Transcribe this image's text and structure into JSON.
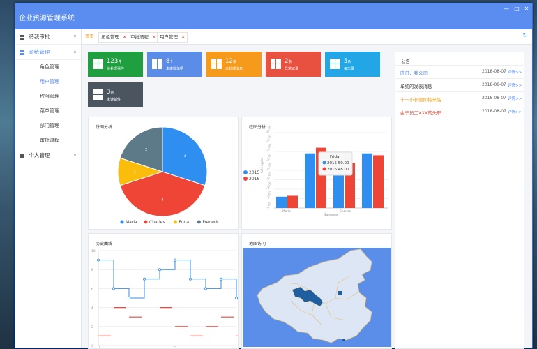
{
  "app": {
    "title": "企业资源管理系统"
  },
  "window_controls": [
    "—",
    "□",
    "✕"
  ],
  "sidebar": {
    "groups": [
      {
        "label": "待我审批",
        "chevron": "∨"
      },
      {
        "label": "系统管理",
        "chevron": "∧",
        "items": [
          "角色管理",
          "用户管理",
          "权限管理",
          "菜单管理",
          "部门管理",
          "审批流程"
        ]
      },
      {
        "label": "个人管理",
        "chevron": "∨"
      }
    ]
  },
  "tabs": {
    "home": "首页",
    "items": [
      "角色管理",
      "审批流程",
      "用户管理"
    ],
    "close": "✕",
    "refresh_icon": "↻"
  },
  "tiles": [
    {
      "num": "123",
      "unit": "件",
      "label": "待处理事件",
      "color": "#1f9f3f"
    },
    {
      "num": "8",
      "unit": "个",
      "label": "未审批单据",
      "color": "#5b8de8"
    },
    {
      "num": "12",
      "unit": "条",
      "label": "未处理消息",
      "color": "#f59a1b"
    },
    {
      "num": "2",
      "unit": "条",
      "label": "异常记录",
      "color": "#e85040"
    },
    {
      "num": "5",
      "unit": "条",
      "label": "备忘录",
      "color": "#22a6e6"
    },
    {
      "num": "3",
      "unit": "条",
      "label": "未读邮件",
      "color": "#4a5560"
    }
  ],
  "panels": {
    "pie_title": "饼图分析",
    "bar_title": "柱图分析",
    "line_title": "历史曲线",
    "map_title": "地图访问",
    "notice_title": "公告"
  },
  "notices": [
    {
      "text": "昨日，我公司",
      "date": "2018-08-07",
      "more": "详情>>",
      "color": "#5b8df0"
    },
    {
      "text": "单纯的发表消息",
      "date": "2018-08-07",
      "more": "详情>>",
      "color": "#333333"
    },
    {
      "text": "十一小长假即将来临",
      "date": "2018-08-07",
      "more": "详情>>",
      "color": "#f0a020"
    },
    {
      "text": "由于员工XXX的失职...",
      "date": "2018-08-07",
      "more": "详情>>",
      "color": "#e04b3a"
    }
  ],
  "chart_data": [
    {
      "type": "pie",
      "title": "饼图分析",
      "categories": [
        "Maria",
        "Charles",
        "Frida",
        "Frederic"
      ],
      "values": [
        3,
        4,
        1,
        2
      ],
      "slice_labels": [
        "3",
        "4",
        "1",
        "2"
      ],
      "colors": [
        "#2f8ff0",
        "#ee4537",
        "#fbbd0c",
        "#5d7a88"
      ],
      "legend": "bottom"
    },
    {
      "type": "bar",
      "title": "柱图分析",
      "xlabel": "Salesman",
      "ylabel": "Sold Apple",
      "categories": [
        "Maria",
        "",
        "Charles",
        ""
      ],
      "yticks": [
        "0.00",
        "10.00",
        "20.00",
        "30.00",
        "40.00",
        "50.00",
        "60.00",
        "70.00",
        "80.00"
      ],
      "ylim": [
        0,
        80
      ],
      "series": [
        {
          "name": "2015",
          "color": "#2f8ff0",
          "values": [
            12,
            58,
            50,
            58
          ]
        },
        {
          "name": "2016",
          "color": "#ee4537",
          "values": [
            13,
            64,
            48,
            56
          ]
        }
      ],
      "tooltip": {
        "title": "Frida",
        "rows": [
          "2015  50.00",
          "2016  48.00"
        ]
      },
      "legend": "left"
    },
    {
      "type": "line",
      "title": "历史曲线",
      "yticks": [
        "0",
        "2",
        "4",
        "6",
        "8",
        "10"
      ],
      "xticks": [
        "0",
        "5"
      ],
      "ylim": [
        0,
        10
      ],
      "step_series": {
        "x": [
          0,
          1,
          2,
          3,
          4,
          5,
          6,
          7,
          8,
          9
        ],
        "y": [
          9,
          6,
          5,
          7,
          8,
          9,
          7,
          6,
          7,
          5
        ],
        "color": "#3a8ee6"
      },
      "segments": [
        {
          "x": 0,
          "y": 1
        },
        {
          "x": 1,
          "y": 4
        },
        {
          "x": 2,
          "y": 3
        },
        {
          "x": 4,
          "y": 4
        },
        {
          "x": 5,
          "y": 2
        },
        {
          "x": 6,
          "y": 1
        },
        {
          "x": 7,
          "y": 2
        },
        {
          "x": 8,
          "y": 3
        },
        {
          "x": 9,
          "y": 1
        }
      ]
    }
  ]
}
